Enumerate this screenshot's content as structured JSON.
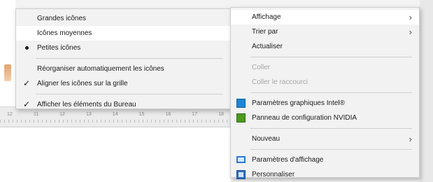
{
  "submenu": {
    "items": [
      {
        "label": "Grandes icônes"
      },
      {
        "label": "Icônes moyennes"
      },
      {
        "label": "Petites icônes"
      },
      {
        "label": "Réorganiser automatiquement les icônes"
      },
      {
        "label": "Aligner les icônes sur la grille"
      },
      {
        "label": "Afficher les éléments du Bureau"
      }
    ],
    "bullet_glyph": "•",
    "check_glyph": "✓"
  },
  "mainmenu": {
    "items": [
      {
        "label": "Affichage",
        "icon": "chevron-right-icon"
      },
      {
        "label": "Trier par",
        "icon": "chevron-right-icon"
      },
      {
        "label": "Actualiser"
      },
      {
        "label": "Coller"
      },
      {
        "label": "Coller le raccourci"
      },
      {
        "label": "Paramètres graphiques Intel®",
        "icon": "intel-graphics-icon"
      },
      {
        "label": "Panneau de configuration NVIDIA",
        "icon": "nvidia-icon"
      },
      {
        "label": "Nouveau",
        "icon": "chevron-right-icon"
      },
      {
        "label": "Paramètres d'affichage",
        "icon": "display-settings-icon"
      },
      {
        "label": "Personnaliser",
        "icon": "personalize-icon"
      }
    ],
    "chevron_glyph": "›"
  },
  "ruler": {
    "ticks": [
      "12",
      "11",
      "12",
      "13",
      "14",
      "15",
      "16",
      "17",
      "18"
    ]
  },
  "colors": {
    "menu_bg": "#f2f2f2",
    "highlight": "#ffffff",
    "disabled_text": "#a8a8a8",
    "intel_blue": "#1d86d6",
    "nvidia_green": "#4c9a1e"
  }
}
